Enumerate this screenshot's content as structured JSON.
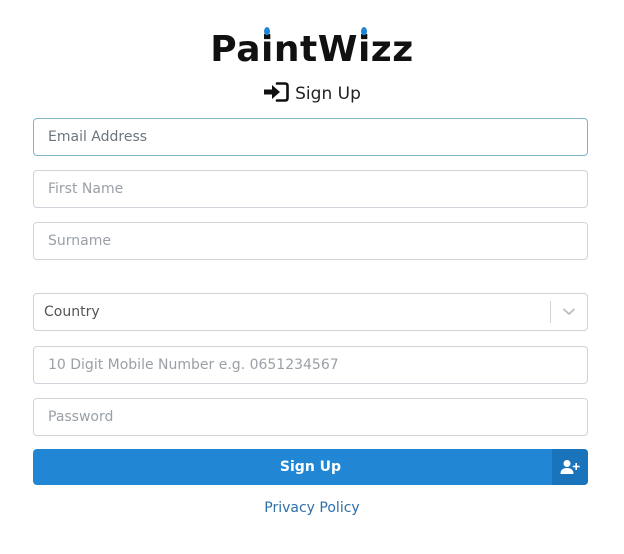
{
  "brand": {
    "name": "PaintWizz",
    "drop_color": "#1f86d4"
  },
  "heading": {
    "icon": "sign-in-icon",
    "text": "Sign Up"
  },
  "form": {
    "email": {
      "placeholder": "Email Address",
      "value": ""
    },
    "first_name": {
      "placeholder": "First Name",
      "value": ""
    },
    "surname": {
      "placeholder": "Surname",
      "value": ""
    },
    "country": {
      "selected": "Country",
      "icon": "chevron-down-icon"
    },
    "mobile": {
      "placeholder": "10 Digit Mobile Number e.g. 0651234567",
      "value": ""
    },
    "password": {
      "placeholder": "Password",
      "value": ""
    }
  },
  "submit": {
    "label": "Sign Up",
    "icon": "add-user-icon",
    "color": "#2186d4"
  },
  "footer": {
    "privacy_label": "Privacy Policy"
  }
}
